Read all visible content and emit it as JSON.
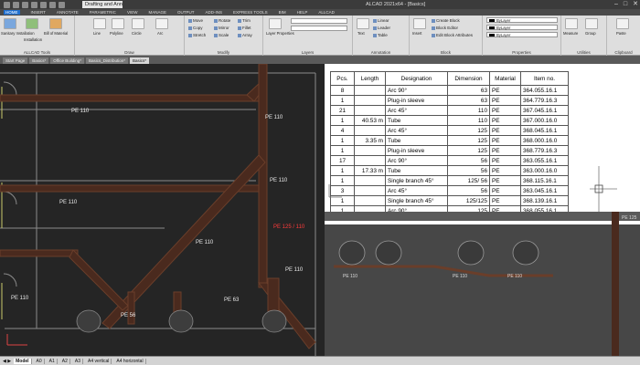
{
  "window": {
    "workspace": "Drafting and Annotation",
    "title": "ALCAD 2021x64 - [Basics]",
    "controls": [
      "–",
      "□",
      "✕"
    ]
  },
  "menu_tabs": [
    "HOME",
    "INSERT",
    "ANNOTATE",
    "PARAMETRIC",
    "VIEW",
    "MANAGE",
    "OUTPUT",
    "ADD-INS",
    "EXPRESS TOOLS",
    "BIM",
    "HELP",
    "ALLCAD"
  ],
  "ribbon": {
    "panels": {
      "tools": "ALLCAD Tools",
      "draw": "Draw",
      "modify": "Modify",
      "layers": "Layers",
      "annotation": "Annotation",
      "block": "Block",
      "properties": "Properties",
      "utilities": "Utilities",
      "clipboard": "Clipboard"
    },
    "buttons": {
      "sanitary": "Sanitary Installation",
      "selection": "Installation",
      "bill": "Bill of Material",
      "line": "Line",
      "polyline": "Polyline",
      "circle": "Circle",
      "arc": "Arc",
      "move": "Move",
      "copy": "Copy",
      "stretch": "Stretch",
      "rotate": "Rotate",
      "mirror": "Mirror",
      "scale": "Scale",
      "trim": "Trim",
      "fillet": "Fillet",
      "array": "Array",
      "layer_props": "Layer Properties",
      "text": "Text",
      "linear": "Linear",
      "leader": "Leader",
      "table": "Table",
      "insert": "Insert",
      "create": "Create Block",
      "edit": "Block Editor",
      "attr": "Edit Block Attributes",
      "measure": "Measure",
      "group": "Group",
      "paste": "Paste"
    },
    "properties": [
      "ByLayer",
      "ByLayer",
      "ByLayer"
    ]
  },
  "doc_tabs": [
    "Start Page",
    "Basics*",
    "Office Building*",
    "Basics_Distribution*",
    "Basics*"
  ],
  "table": {
    "headers": [
      "Pcs.",
      "Length",
      "Designation",
      "Dimension",
      "Material",
      "Item no."
    ],
    "rows": [
      [
        "8",
        "",
        "Arc 90°",
        "63",
        "PE",
        "364.055.16.1"
      ],
      [
        "1",
        "",
        "Plug-in sleeve",
        "63",
        "PE",
        "364.779.16.3"
      ],
      [
        "21",
        "",
        "Arc 45°",
        "110",
        "PE",
        "367.045.16.1"
      ],
      [
        "1",
        "40.53 m",
        "Tube",
        "110",
        "PE",
        "367.000.16.0"
      ],
      [
        "4",
        "",
        "Arc 45°",
        "125",
        "PE",
        "368.045.16.1"
      ],
      [
        "1",
        "3.35 m",
        "Tube",
        "125",
        "PE",
        "368.000.16.0"
      ],
      [
        "1",
        "",
        "Plug-in sleeve",
        "125",
        "PE",
        "368.779.16.3"
      ],
      [
        "17",
        "",
        "Arc 90°",
        "56",
        "PE",
        "363.055.16.1"
      ],
      [
        "1",
        "17.33 m",
        "Tube",
        "56",
        "PE",
        "363.000.16.0"
      ],
      [
        "1",
        "",
        "Single branch 45°",
        "125/ 56",
        "PE",
        "368.115.16.1"
      ],
      [
        "3",
        "",
        "Arc 45°",
        "56",
        "PE",
        "363.045.16.1"
      ],
      [
        "1",
        "",
        "Single branch 45°",
        "125/125",
        "PE",
        "368.139.16.1"
      ],
      [
        "1",
        "",
        "Arc 90°",
        "125",
        "PE",
        "368.055.16.1"
      ]
    ]
  },
  "drawing_labels": {
    "pe110": "PE 110",
    "pe125": "PE 125",
    "pe63": "PE 63",
    "pe56": "PE 56",
    "red_label": "PE 125 / 110"
  },
  "layout_tabs": [
    "Model",
    "A0",
    "A1",
    "A2",
    "A3",
    "A4 vertical",
    "A4 horizontal"
  ],
  "colors": {
    "pipe": "#4a2a1e",
    "pipe_edge": "#6a3e2a",
    "wall": "#9a9a9a",
    "accent": "#1f6fd0"
  }
}
